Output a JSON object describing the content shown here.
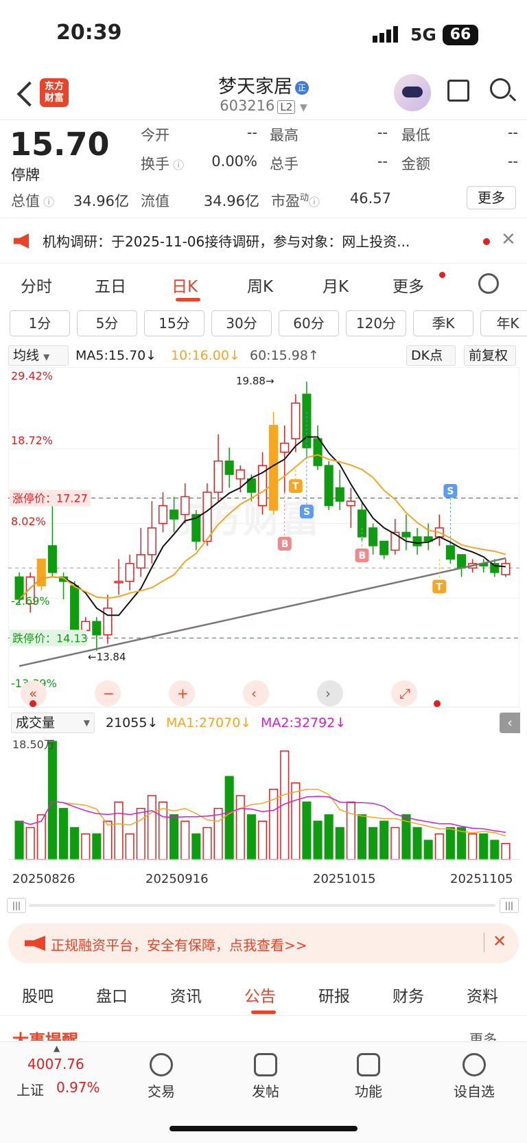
{
  "status": {
    "time": "20:39",
    "network": "5G",
    "battery": "66"
  },
  "header": {
    "logo": "东方财富",
    "name": "梦天家居",
    "badge": "正",
    "code": "603216",
    "level": "L2"
  },
  "quote": {
    "price": "15.70",
    "state": "停牌",
    "fields": [
      {
        "label": "今开",
        "value": "--"
      },
      {
        "label": "最高",
        "value": "--"
      },
      {
        "label": "最低",
        "value": "--"
      },
      {
        "label": "换手",
        "value": "0.00%"
      },
      {
        "label": "总手",
        "value": "--"
      },
      {
        "label": "金额",
        "value": "--"
      },
      {
        "label": "总值",
        "value": "34.96亿"
      },
      {
        "label": "流值",
        "value": "34.96亿"
      },
      {
        "label": "市盈",
        "value": "46.57"
      }
    ],
    "pe_sup": "动",
    "more": "更多"
  },
  "notice": {
    "text": "机构调研：于2025-11-06接待调研，参与对象：网上投资..."
  },
  "period_tabs": [
    "分时",
    "五日",
    "日K",
    "周K",
    "月K",
    "更多"
  ],
  "minute_tabs": [
    "1分",
    "5分",
    "15分",
    "30分",
    "60分",
    "120分",
    "季K",
    "年K"
  ],
  "kline_legend": {
    "selector": "均线",
    "ma5": "MA5:15.70↓",
    "ma10": "10:16.00↓",
    "ma60": "60:15.98↑",
    "dk": "DK点",
    "fq": "前复权"
  },
  "chart_data": {
    "type": "candlestick",
    "y_labels": [
      "29.42%",
      "18.72%",
      "8.02%",
      "-2.69%",
      "-13.39%"
    ],
    "limit_up": "涨停价：17.27",
    "limit_down": "跌停价：14.13",
    "high_mark": "19.88→",
    "low_mark": "←13.84",
    "candles": [
      {
        "o": 15.5,
        "c": 15.0,
        "h": 15.6,
        "l": 14.9
      },
      {
        "o": 14.9,
        "c": 15.5,
        "h": 15.6,
        "l": 14.7
      },
      {
        "o": 15.3,
        "c": 15.9,
        "h": 15.9,
        "l": 15.2
      },
      {
        "o": 16.2,
        "c": 15.6,
        "h": 17.4,
        "l": 15.5
      },
      {
        "o": 15.5,
        "c": 15.4,
        "h": 15.6,
        "l": 15.0
      },
      {
        "o": 15.3,
        "c": 14.3,
        "h": 15.4,
        "l": 14.2
      },
      {
        "o": 14.3,
        "c": 14.5,
        "h": 14.6,
        "l": 14.0
      },
      {
        "o": 14.5,
        "c": 14.2,
        "h": 14.6,
        "l": 13.84
      },
      {
        "o": 14.2,
        "c": 14.8,
        "h": 15.1,
        "l": 14.0
      },
      {
        "o": 15.4,
        "c": 15.4,
        "h": 15.9,
        "l": 15.1
      },
      {
        "o": 15.4,
        "c": 15.8,
        "h": 16.0,
        "l": 15.2
      },
      {
        "o": 15.7,
        "c": 16.0,
        "h": 16.6,
        "l": 15.5
      },
      {
        "o": 16.0,
        "c": 16.6,
        "h": 17.2,
        "l": 15.8
      },
      {
        "o": 16.7,
        "c": 17.1,
        "h": 17.4,
        "l": 16.5
      },
      {
        "o": 17.0,
        "c": 16.8,
        "h": 17.3,
        "l": 16.5
      },
      {
        "o": 16.9,
        "c": 17.3,
        "h": 17.6,
        "l": 16.7
      },
      {
        "o": 16.9,
        "c": 16.3,
        "h": 17.0,
        "l": 16.1
      },
      {
        "o": 16.3,
        "c": 17.4,
        "h": 17.6,
        "l": 16.2
      },
      {
        "o": 17.4,
        "c": 18.1,
        "h": 18.7,
        "l": 17.2
      },
      {
        "o": 18.1,
        "c": 17.8,
        "h": 18.4,
        "l": 17.5
      },
      {
        "o": 17.7,
        "c": 17.9,
        "h": 18.0,
        "l": 17.4
      },
      {
        "o": 17.7,
        "c": 17.4,
        "h": 17.8,
        "l": 17.2
      },
      {
        "o": 17.1,
        "c": 18.0,
        "h": 18.3,
        "l": 16.9
      },
      {
        "o": 17.0,
        "c": 18.9,
        "h": 19.2,
        "l": 16.9
      },
      {
        "o": 18.3,
        "c": 18.5,
        "h": 18.9,
        "l": 17.4
      },
      {
        "o": 18.6,
        "c": 19.4,
        "h": 19.6,
        "l": 18.3
      },
      {
        "o": 19.6,
        "c": 18.4,
        "h": 19.88,
        "l": 18.2
      },
      {
        "o": 18.6,
        "c": 18.0,
        "h": 18.9,
        "l": 17.9
      },
      {
        "o": 18.0,
        "c": 17.1,
        "h": 18.1,
        "l": 17.0
      },
      {
        "o": 17.5,
        "c": 17.2,
        "h": 17.9,
        "l": 17.0
      },
      {
        "o": 17.1,
        "c": 17.2,
        "h": 17.5,
        "l": 16.6
      },
      {
        "o": 17.0,
        "c": 16.4,
        "h": 17.2,
        "l": 16.3
      },
      {
        "o": 16.6,
        "c": 16.2,
        "h": 16.7,
        "l": 16.0
      },
      {
        "o": 16.3,
        "c": 16.0,
        "h": 16.3,
        "l": 15.9
      },
      {
        "o": 16.1,
        "c": 16.5,
        "h": 16.8,
        "l": 16.0
      },
      {
        "o": 16.5,
        "c": 16.4,
        "h": 16.9,
        "l": 16.1
      },
      {
        "o": 16.4,
        "c": 16.2,
        "h": 16.6,
        "l": 16.0
      },
      {
        "o": 16.4,
        "c": 16.3,
        "h": 16.7,
        "l": 16.1
      },
      {
        "o": 16.4,
        "c": 16.6,
        "h": 16.9,
        "l": 16.2
      },
      {
        "o": 16.2,
        "c": 15.9,
        "h": 16.3,
        "l": 15.8
      },
      {
        "o": 16.0,
        "c": 15.7,
        "h": 16.0,
        "l": 15.5
      },
      {
        "o": 15.7,
        "c": 15.8,
        "h": 15.9,
        "l": 15.6
      },
      {
        "o": 15.8,
        "c": 15.75,
        "h": 15.9,
        "l": 15.6
      },
      {
        "o": 15.8,
        "c": 15.6,
        "h": 15.9,
        "l": 15.5
      },
      {
        "o": 15.55,
        "c": 15.8,
        "h": 15.9,
        "l": 15.5
      }
    ],
    "volumes": [
      6,
      5,
      7,
      18.5,
      8,
      5,
      4,
      4,
      6,
      9,
      4,
      8,
      10,
      9,
      7,
      6,
      4,
      5,
      8,
      13,
      10,
      7,
      6,
      11,
      17,
      12,
      9,
      6,
      7,
      5,
      9,
      7,
      5,
      6,
      5,
      7,
      5,
      3,
      4,
      5,
      5,
      4,
      4,
      3,
      2.5
    ],
    "signals": [
      "B",
      "B",
      "S",
      "S",
      "T",
      "T"
    ]
  },
  "volume_legend": {
    "selector": "成交量",
    "vol": "21055↓",
    "ma1": "MA1:27070↓",
    "ma2": "MA2:32792↓",
    "max": "18.50万"
  },
  "dates": [
    "20250826",
    "20250916",
    "20251015",
    "20251105"
  ],
  "ad": {
    "text": "正规融资平台，安全有保障，点我查看>>"
  },
  "bottom_tabs": [
    "股吧",
    "盘口",
    "资讯",
    "公告",
    "研报",
    "财务",
    "资料"
  ],
  "section_peek": {
    "title": "大事提醒",
    "more": "更多"
  },
  "footer": {
    "index_value": "4007.76",
    "index_name": "上证",
    "index_change": "0.97%",
    "items": [
      "交易",
      "发帖",
      "功能",
      "设自选"
    ]
  },
  "colors": {
    "up": "#e02020",
    "down": "#109c10",
    "accent": "#e9442a"
  }
}
